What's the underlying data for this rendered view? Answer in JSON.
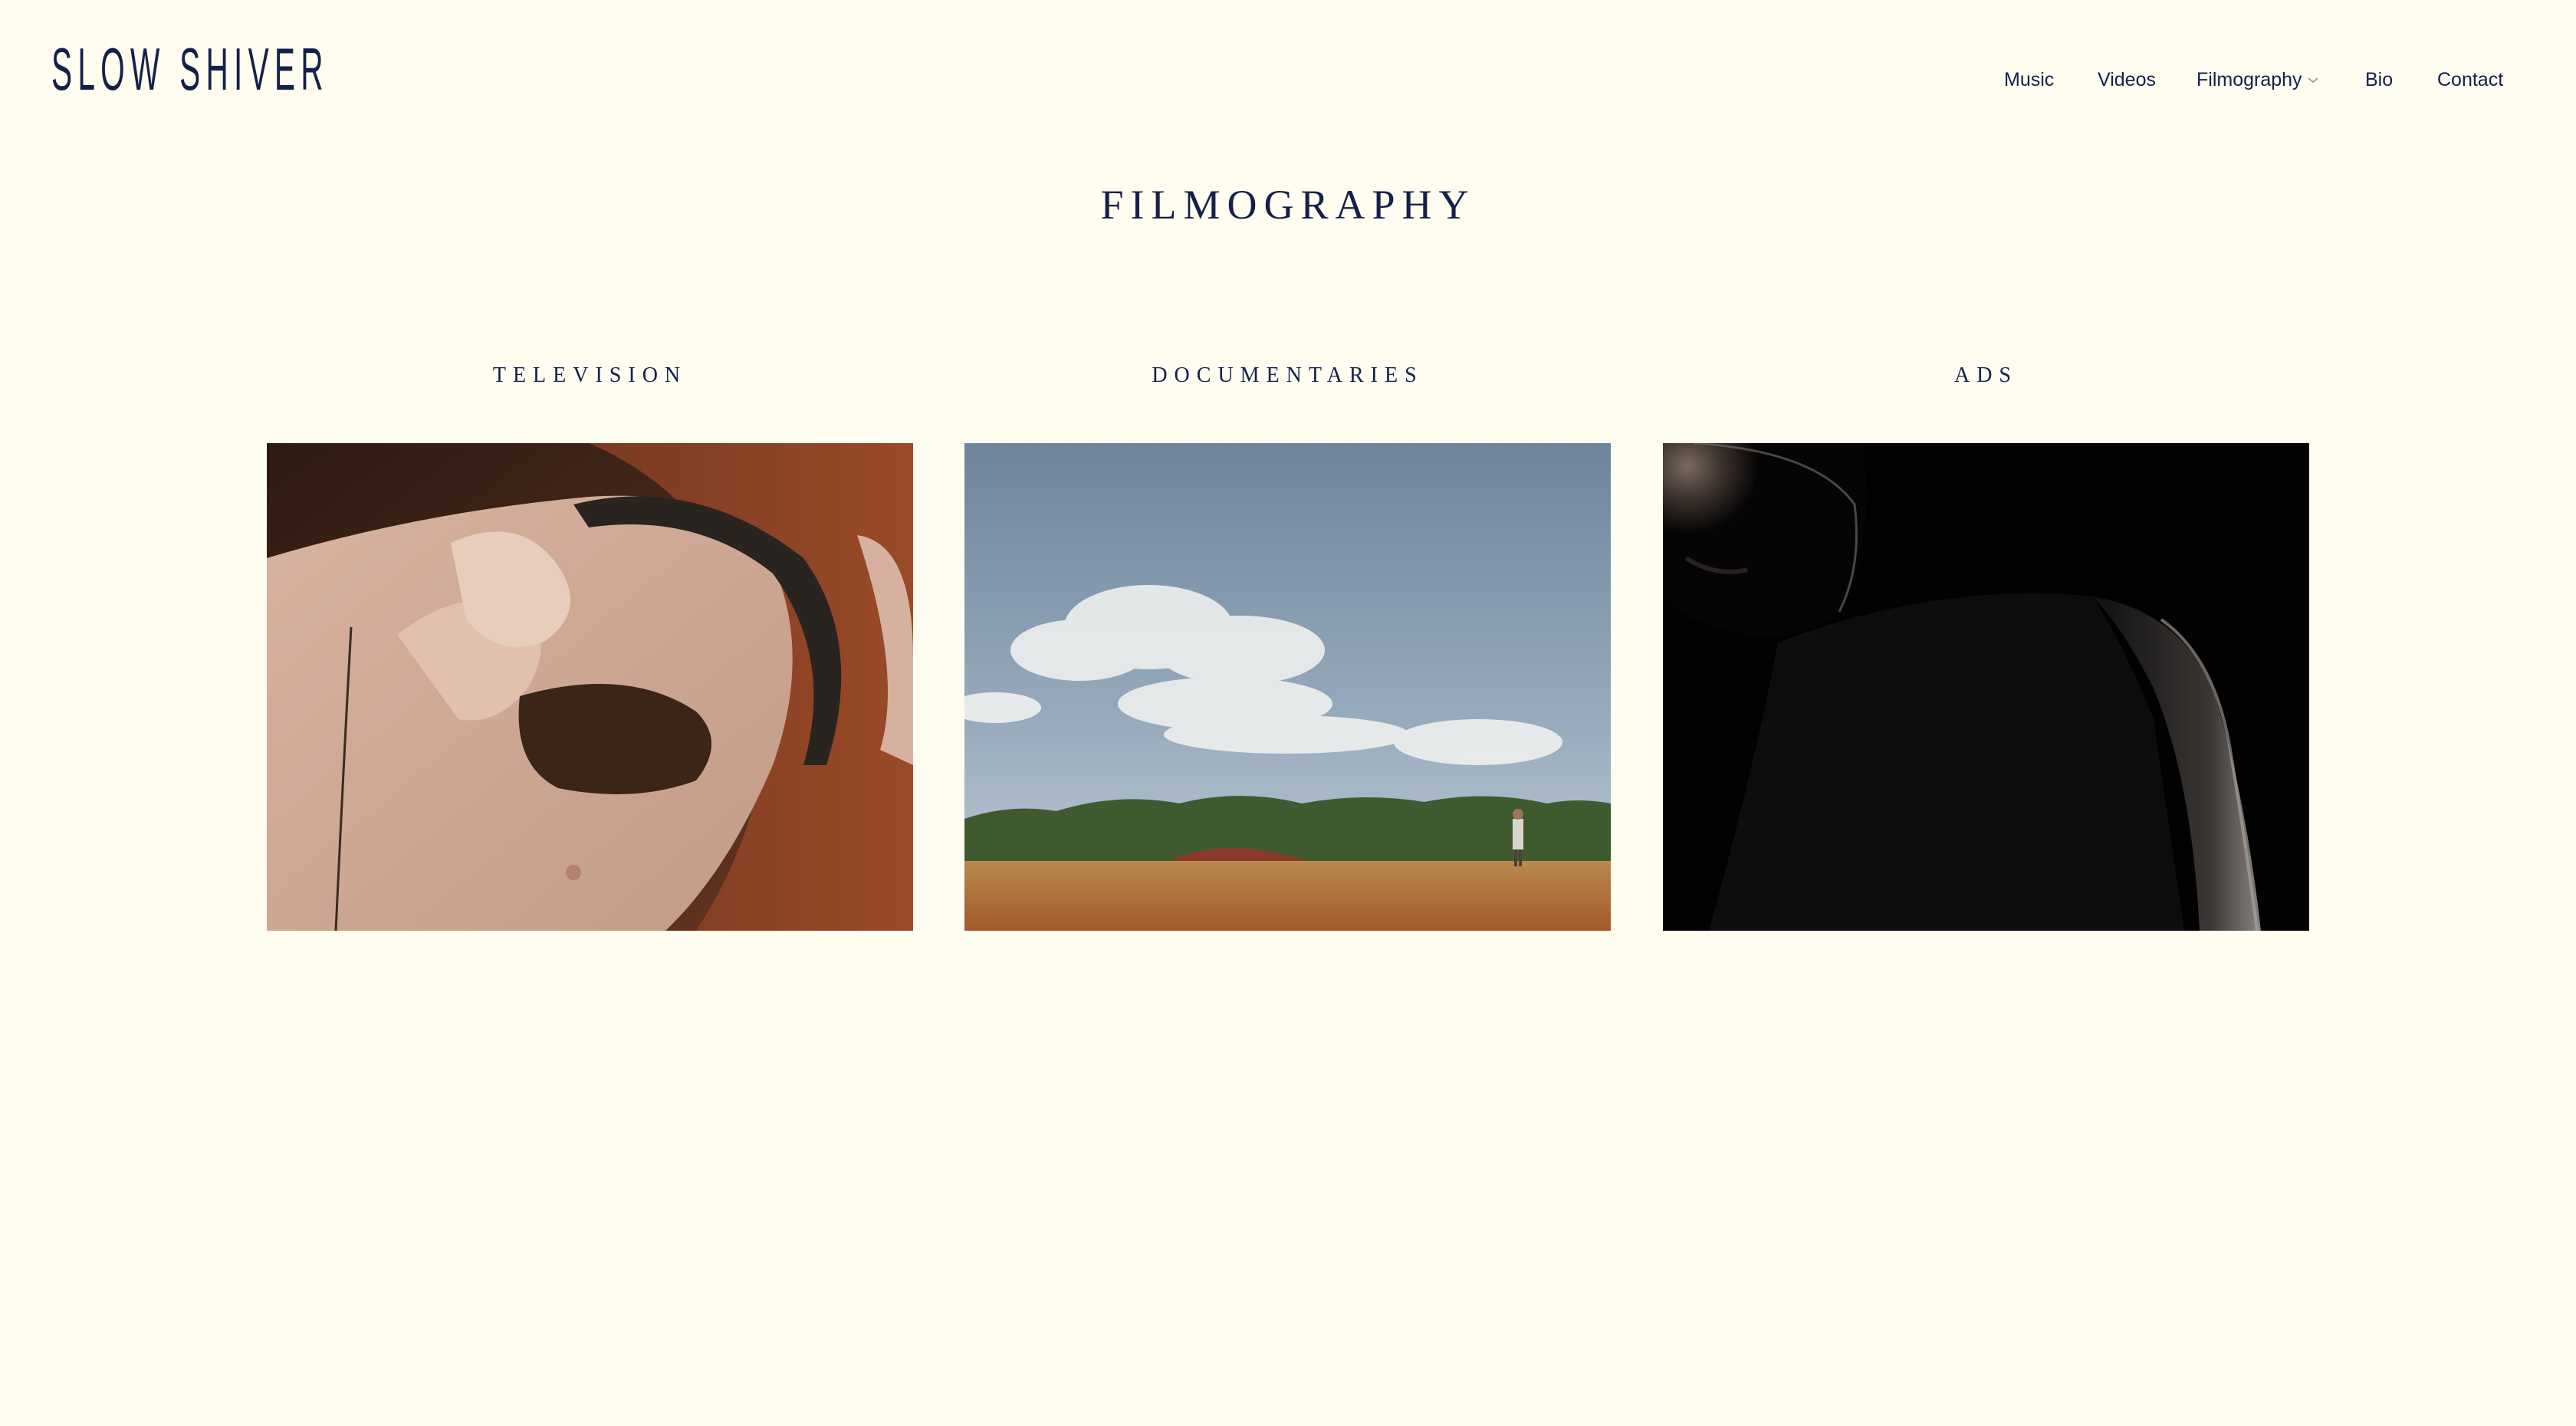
{
  "site": {
    "logo": "SLOW SHIVER"
  },
  "nav": {
    "items": [
      {
        "label": "Music"
      },
      {
        "label": "Videos"
      },
      {
        "label": "Filmography",
        "has_dropdown": true
      },
      {
        "label": "Bio"
      },
      {
        "label": "Contact"
      }
    ]
  },
  "page": {
    "title": "FILMOGRAPHY"
  },
  "categories": [
    {
      "label": "TELEVISION"
    },
    {
      "label": "DOCUMENTARIES"
    },
    {
      "label": "ADS"
    }
  ],
  "colors": {
    "background": "#fffcf0",
    "text": "#15204a"
  },
  "icons": {
    "dropdown": "chevron-down-icon"
  }
}
